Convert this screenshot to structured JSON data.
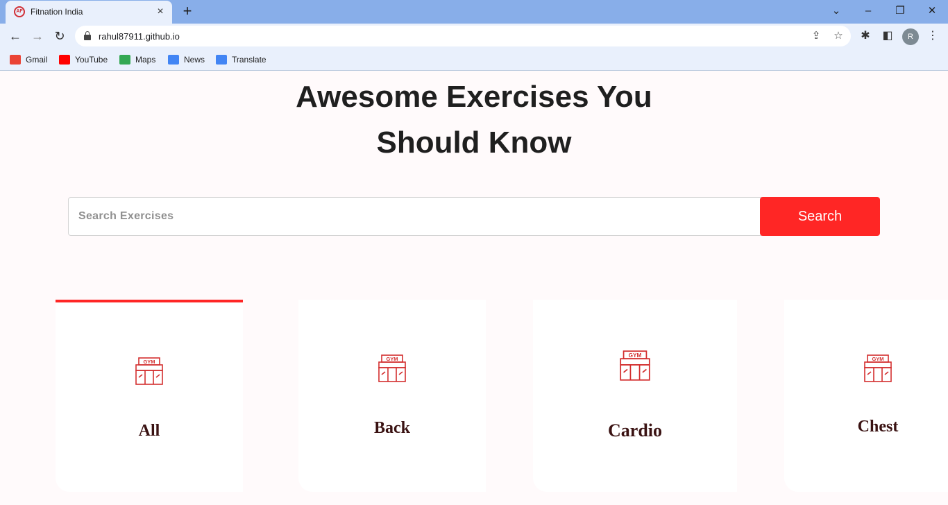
{
  "browser": {
    "tab_title": "Fitnation India",
    "favicon_text": "AF",
    "url": "rahul87911.github.io",
    "profile_initial": "R",
    "bookmarks": [
      {
        "label": "Gmail",
        "icon": "gmail-icon",
        "color": "#ea4335"
      },
      {
        "label": "YouTube",
        "icon": "youtube-icon",
        "color": "#ff0000"
      },
      {
        "label": "Maps",
        "icon": "maps-icon",
        "color": "#34a853"
      },
      {
        "label": "News",
        "icon": "news-icon",
        "color": "#4285f4"
      },
      {
        "label": "Translate",
        "icon": "translate-icon",
        "color": "#4285f4"
      }
    ]
  },
  "hero": {
    "title_line1": "Awesome Exercises You",
    "title_line2": "Should Know"
  },
  "search": {
    "placeholder": "Search Exercises",
    "value": "",
    "button_label": "Search"
  },
  "body_parts": [
    {
      "label": "All",
      "icon": "gym-icon",
      "active": true
    },
    {
      "label": "Back",
      "icon": "gym-icon",
      "active": false
    },
    {
      "label": "Cardio",
      "icon": "gym-icon",
      "active": false
    },
    {
      "label": "Chest",
      "icon": "gym-icon",
      "active": false
    }
  ],
  "colors": {
    "accent": "#ff2625",
    "page_bg": "#fffafb",
    "card_label": "#3a1212"
  }
}
